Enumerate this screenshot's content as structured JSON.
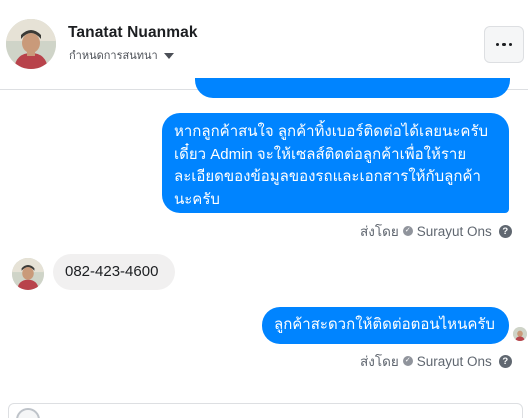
{
  "header": {
    "name": "Tanatat Nuanmak",
    "subtitle": "กำหนดการสนทนา",
    "avatar_icon": "profile-photo",
    "more_icon": "ellipsis-icon"
  },
  "messages": [
    {
      "id": "m1",
      "direction": "outgoing",
      "text": "หากลูกค้าสนใจ ลูกค้าทิ้งเบอร์ติดต่อได้เลยนะครับ เดี๋ยว Admin จะให้เซลส์ติดต่อลูกค้าเพื่อให้รายละเอียดของข้อมูลของรถและเอกสารให้กับลูกค้านะครับ",
      "lines": [
        "หากลูกค้าสนใจ ลูกค้าทิ้งเบอร์ติดต่อได้เลยนะครับ",
        "เดี๋ยว Admin จะให้เซลส์ติดต่อลูกค้าเพื่อให้ราย",
        "ละเอียดของข้อมูลของรถและเอกสารให้กับลูกค้า",
        "นะครับ"
      ],
      "sent_by_prefix": "ส่งโดย",
      "sender": "Surayut Ons"
    },
    {
      "id": "m2",
      "direction": "incoming",
      "text": "082-423-4600"
    },
    {
      "id": "m3",
      "direction": "outgoing",
      "text": "ลูกค้าสะดวกให้ติดต่อตอนไหนครับ",
      "sent_by_prefix": "ส่งโดย",
      "sender": "Surayut Ons"
    }
  ],
  "colors": {
    "outgoing_bubble": "#0084ff",
    "incoming_bubble": "#f1f0f0",
    "meta_text": "#606770"
  }
}
